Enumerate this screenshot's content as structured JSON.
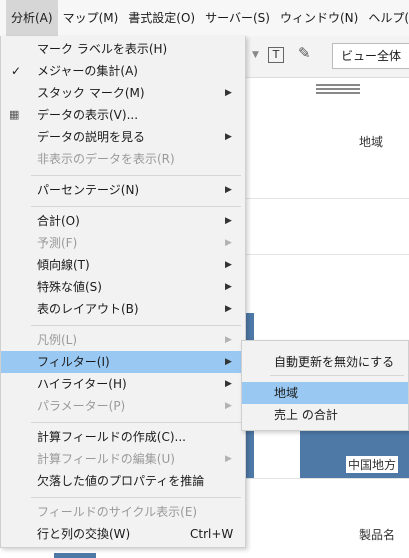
{
  "menubar": {
    "items": [
      "分析(A)",
      "マップ(M)",
      "書式設定(O)",
      "サーバー(S)",
      "ウィンドウ(N)",
      "ヘルプ(H)"
    ]
  },
  "toolbar": {
    "text_tool": "T",
    "view_select_value": "ビュー全体"
  },
  "view": {
    "header_region": "地域",
    "label_chugoku": "中国地方",
    "label_product": "製品名"
  },
  "menu": {
    "items": [
      {
        "label": "マーク ラベルを表示(H)"
      },
      {
        "label": "メジャーの集計(A)",
        "check": "✓"
      },
      {
        "label": "スタック マーク(M)"
      },
      {
        "label": "データの表示(V)..."
      },
      {
        "label": "データの説明を見る"
      },
      {
        "label": "非表示のデータを表示(R)"
      },
      {
        "label": "パーセンテージ(N)"
      },
      {
        "label": "合計(O)"
      },
      {
        "label": "予測(F)"
      },
      {
        "label": "傾向線(T)"
      },
      {
        "label": "特殊な値(S)"
      },
      {
        "label": "表のレイアウト(B)"
      },
      {
        "label": "凡例(L)"
      },
      {
        "label": "フィルター(I)"
      },
      {
        "label": "ハイライター(H)"
      },
      {
        "label": "パラメーター(P)"
      },
      {
        "label": "計算フィールドの作成(C)..."
      },
      {
        "label": "計算フィールドの編集(U)"
      },
      {
        "label": "欠落した値のプロパティを推論"
      },
      {
        "label": "フィールドのサイクル表示(E)"
      },
      {
        "label": "行と列の交換(W)",
        "shortcut": "Ctrl+W"
      }
    ]
  },
  "submenu": {
    "items": [
      {
        "label": "自動更新を無効にする"
      },
      {
        "label": "地域"
      },
      {
        "label": "売上 の合計"
      }
    ]
  }
}
